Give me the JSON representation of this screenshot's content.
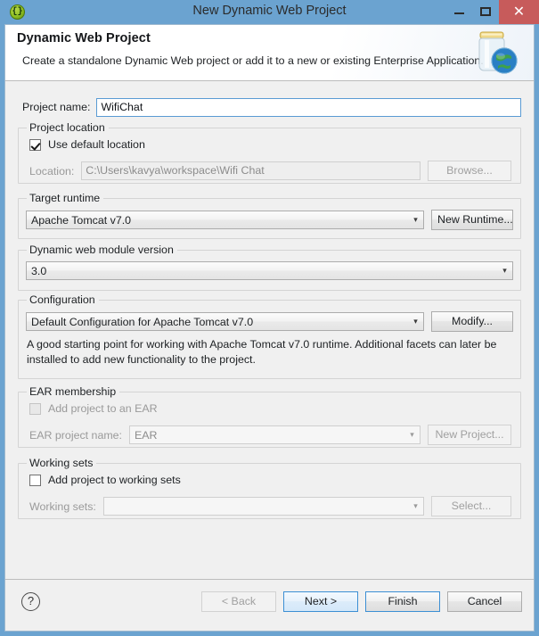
{
  "window": {
    "title": "New Dynamic Web Project",
    "app_icon": "eclipse-braces-icon",
    "minimize_label": "Minimize",
    "maximize_label": "Maximize",
    "close_label": "✕",
    "titlebar_color": "#6ba3d0",
    "close_button_color": "#c75b5b"
  },
  "header": {
    "title": "Dynamic Web Project",
    "description": "Create a standalone Dynamic Web project or add it to a new or existing Enterprise Application.",
    "icon": "jar-with-globe-icon"
  },
  "project_name": {
    "label": "Project name:",
    "value": "WifiChat",
    "placeholder": ""
  },
  "project_location": {
    "group_label": "Project location",
    "use_default_checkbox": {
      "label": "Use default location",
      "checked": true
    },
    "location_label": "Location:",
    "location_value": "C:\\Users\\kavya\\workspace\\Wifi Chat",
    "browse_button": "Browse...",
    "enabled": false
  },
  "target_runtime": {
    "group_label": "Target runtime",
    "selected": "Apache Tomcat v7.0",
    "new_runtime_button": "New Runtime..."
  },
  "module_version": {
    "group_label": "Dynamic web module version",
    "selected": "3.0"
  },
  "configuration": {
    "group_label": "Configuration",
    "selected": "Default Configuration for Apache Tomcat v7.0",
    "modify_button": "Modify...",
    "description": "A good starting point for working with Apache Tomcat v7.0 runtime. Additional facets can later be installed to add new functionality to the project."
  },
  "ear_membership": {
    "group_label": "EAR membership",
    "add_checkbox": {
      "label": "Add project to an EAR",
      "checked": false,
      "enabled": false
    },
    "project_name_label": "EAR project name:",
    "project_name_value": "EAR",
    "new_project_button": "New Project..."
  },
  "working_sets": {
    "group_label": "Working sets",
    "add_checkbox": {
      "label": "Add project to working sets",
      "checked": false,
      "enabled": true
    },
    "working_sets_label": "Working sets:",
    "working_sets_value": "",
    "select_button": "Select..."
  },
  "footer": {
    "help_icon": "question-mark-icon",
    "back_button": "< Back",
    "next_button": "Next >",
    "finish_button": "Finish",
    "cancel_button": "Cancel"
  }
}
